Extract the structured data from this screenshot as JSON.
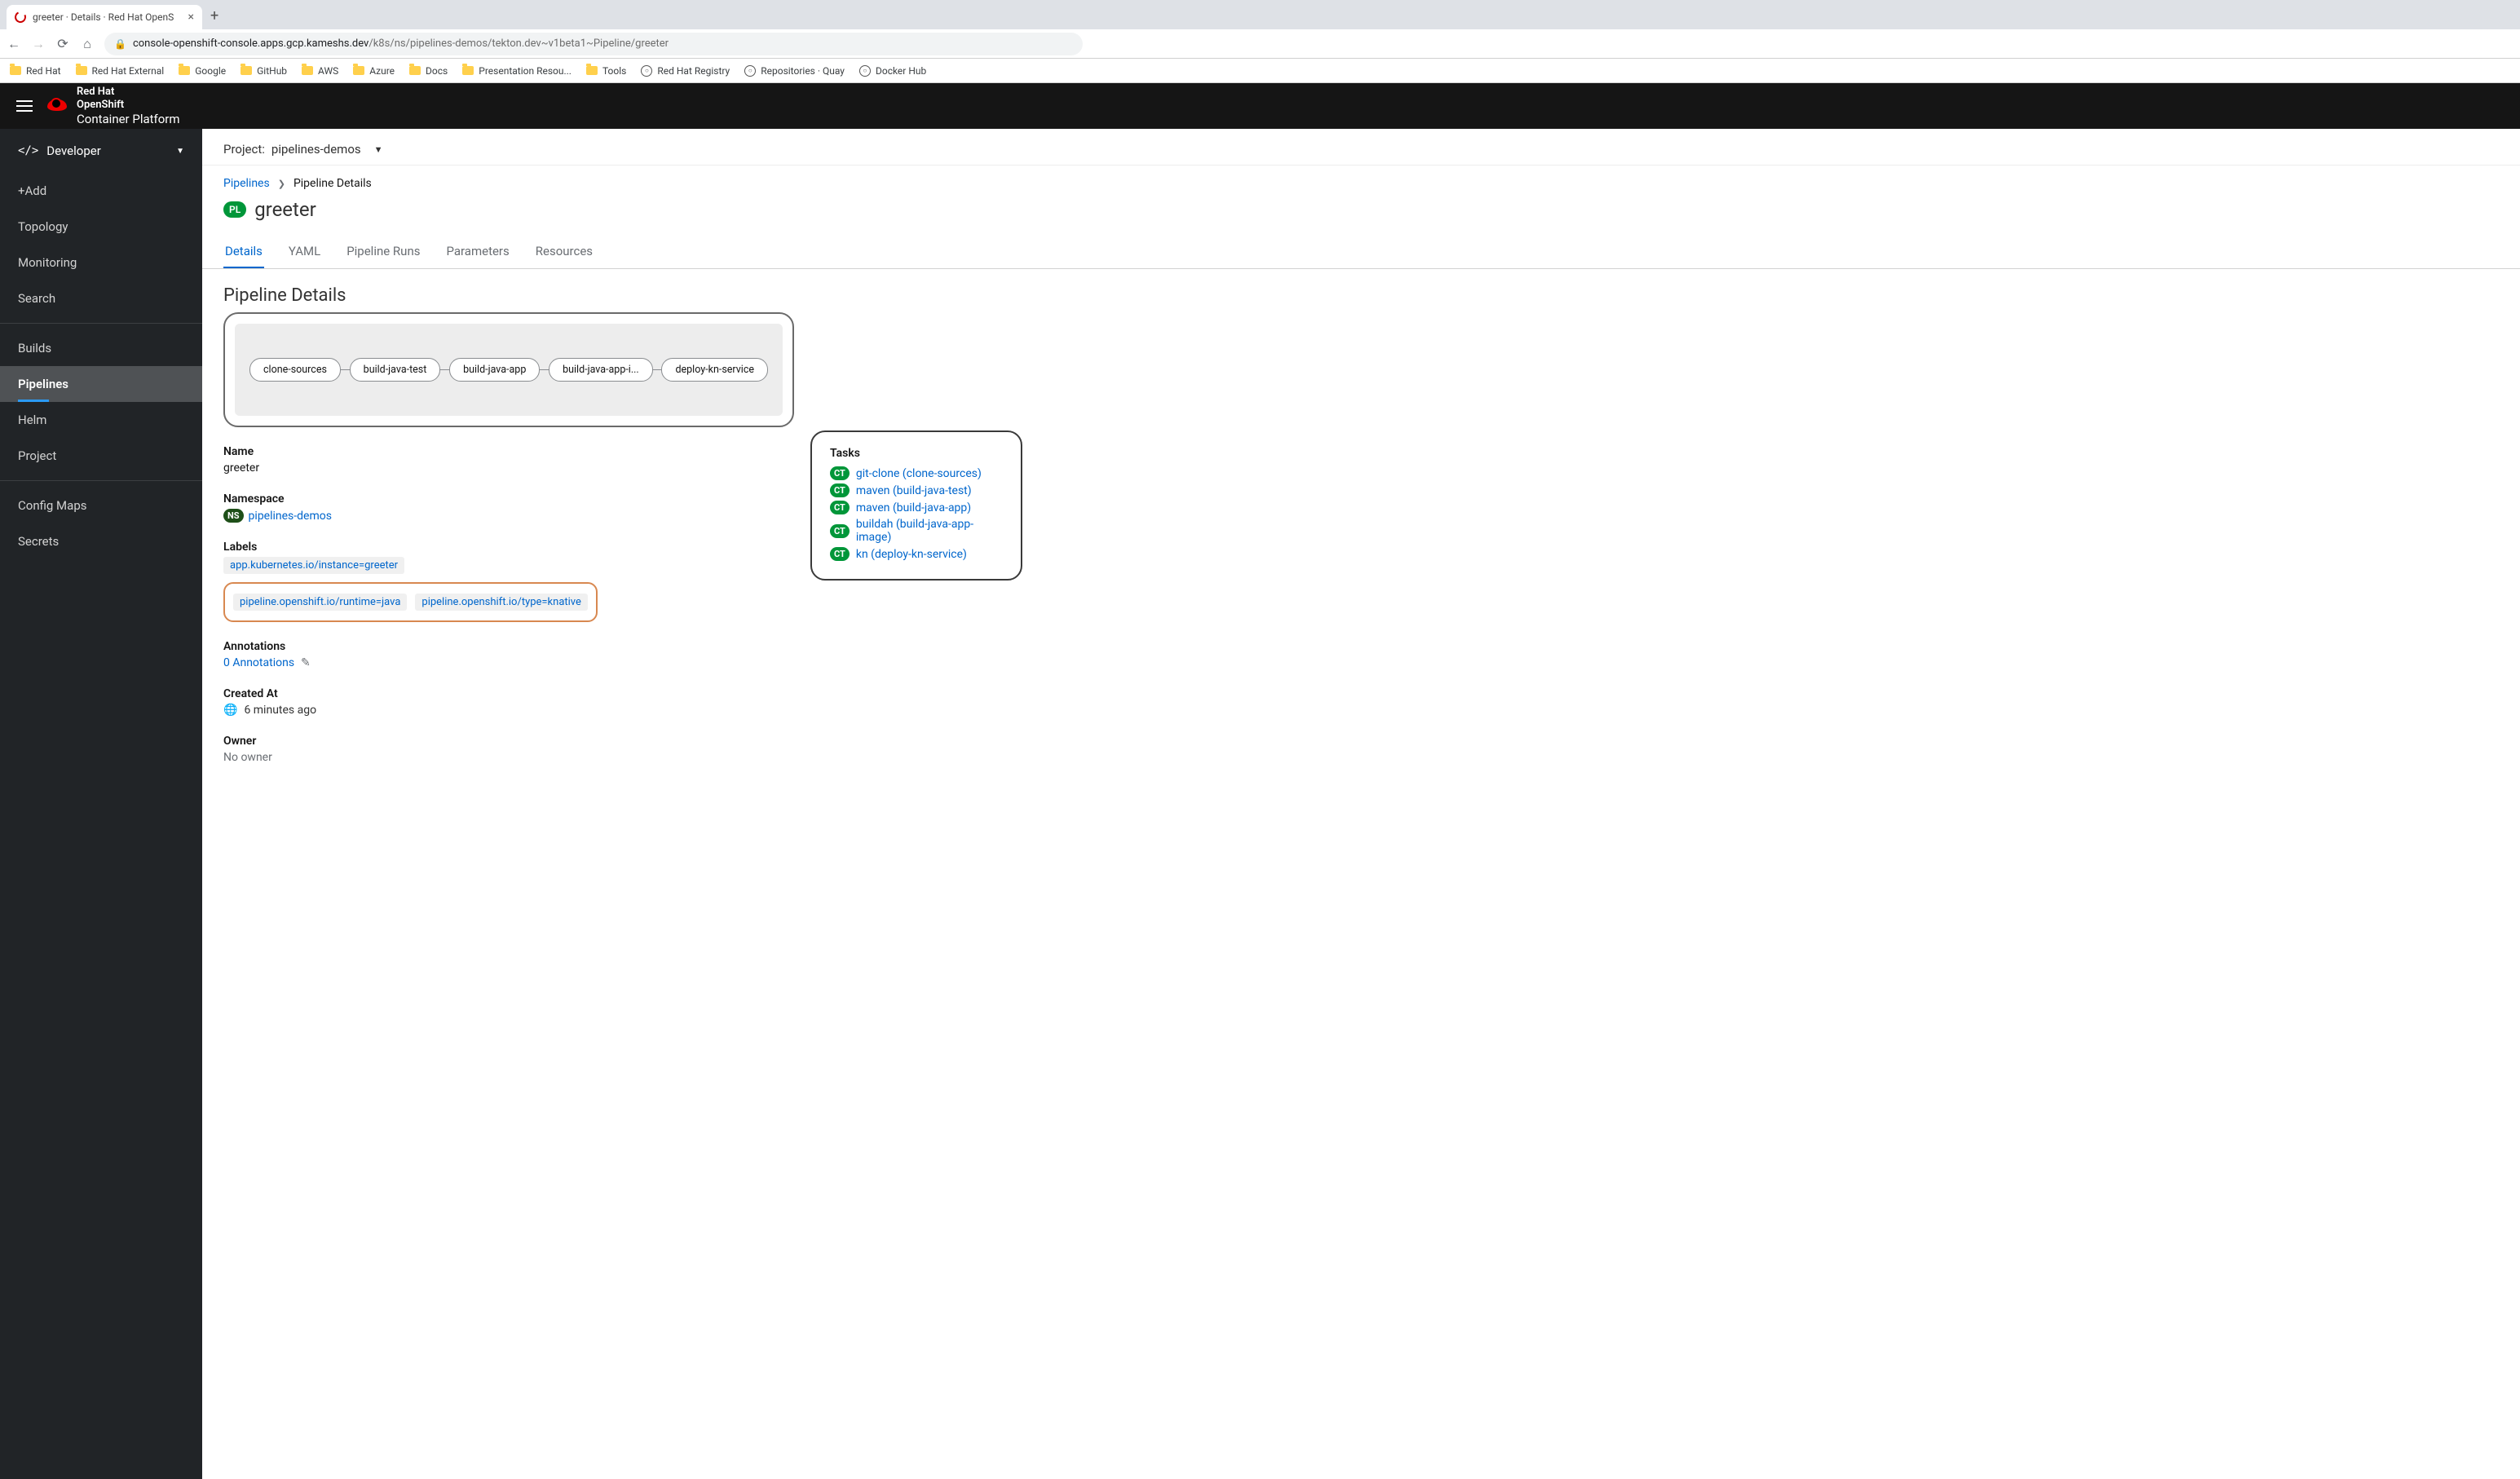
{
  "browser": {
    "tab_title": "greeter · Details · Red Hat OpenS",
    "url_host": "console-openshift-console.apps.gcp.kameshs.dev",
    "url_path": "/k8s/ns/pipelines-demos/tekton.dev~v1beta1~Pipeline/greeter",
    "bookmarks": [
      {
        "label": "Red Hat",
        "type": "folder"
      },
      {
        "label": "Red Hat External",
        "type": "folder"
      },
      {
        "label": "Google",
        "type": "folder"
      },
      {
        "label": "GitHub",
        "type": "folder"
      },
      {
        "label": "AWS",
        "type": "folder"
      },
      {
        "label": "Azure",
        "type": "folder"
      },
      {
        "label": "Docs",
        "type": "folder"
      },
      {
        "label": "Presentation Resou...",
        "type": "folder"
      },
      {
        "label": "Tools",
        "type": "folder"
      },
      {
        "label": "Red Hat Registry",
        "type": "site"
      },
      {
        "label": "Repositories · Quay",
        "type": "site"
      },
      {
        "label": "Docker Hub",
        "type": "site"
      }
    ]
  },
  "brand": {
    "line1": "Red Hat",
    "line2": "OpenShift",
    "line3": "Container Platform"
  },
  "sidebar": {
    "perspective": "Developer",
    "items": [
      {
        "label": "+Add",
        "active": false
      },
      {
        "label": "Topology",
        "active": false
      },
      {
        "label": "Monitoring",
        "active": false
      },
      {
        "label": "Search",
        "active": false
      },
      {
        "label": "Builds",
        "active": false,
        "sep_before": true
      },
      {
        "label": "Pipelines",
        "active": true
      },
      {
        "label": "Helm",
        "active": false
      },
      {
        "label": "Project",
        "active": false
      },
      {
        "label": "Config Maps",
        "active": false,
        "sep_before": true
      },
      {
        "label": "Secrets",
        "active": false
      }
    ]
  },
  "project_bar": {
    "prefix": "Project:",
    "name": "pipelines-demos"
  },
  "breadcrumb": {
    "link": "Pipelines",
    "current": "Pipeline Details"
  },
  "title": {
    "badge": "PL",
    "name": "greeter"
  },
  "tabs": [
    {
      "label": "Details",
      "active": true
    },
    {
      "label": "YAML",
      "active": false
    },
    {
      "label": "Pipeline Runs",
      "active": false
    },
    {
      "label": "Parameters",
      "active": false
    },
    {
      "label": "Resources",
      "active": false
    }
  ],
  "section_heading": "Pipeline Details",
  "pipeline_tasks": [
    "clone-sources",
    "build-java-test",
    "build-java-app",
    "build-java-app-i...",
    "deploy-kn-service"
  ],
  "fields": {
    "name_label": "Name",
    "name_value": "greeter",
    "namespace_label": "Namespace",
    "namespace_badge": "NS",
    "namespace_value": "pipelines-demos",
    "labels_label": "Labels",
    "labels": [
      "app.kubernetes.io/instance=greeter",
      "pipeline.openshift.io/runtime=java",
      "pipeline.openshift.io/type=knative"
    ],
    "annotations_label": "Annotations",
    "annotations_value": "0 Annotations",
    "created_label": "Created At",
    "created_value": "6 minutes ago",
    "owner_label": "Owner",
    "owner_value": "No owner"
  },
  "tasks_panel": {
    "heading": "Tasks",
    "badge": "CT",
    "items": [
      "git-clone (clone-sources)",
      "maven (build-java-test)",
      "maven (build-java-app)",
      "buildah (build-java-app-image)",
      "kn (deploy-kn-service)"
    ]
  }
}
